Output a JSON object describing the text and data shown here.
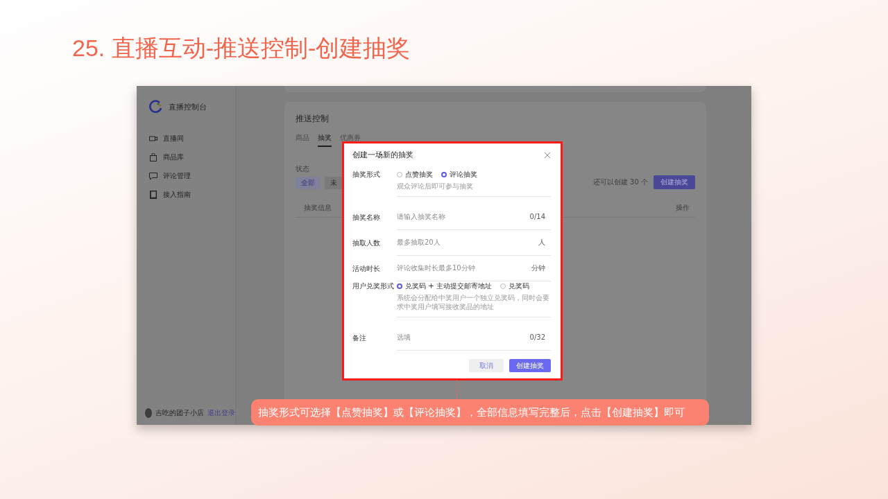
{
  "title": "25. 直播互动-推送控制-创建抽奖",
  "console": {
    "brand": "直播控制台",
    "nav": [
      {
        "label": "直播间"
      },
      {
        "label": "商品库"
      },
      {
        "label": "评论管理"
      },
      {
        "label": "接入指南"
      }
    ],
    "user": {
      "name": "吉吃的团子小店",
      "logout": "退出登录"
    }
  },
  "panel": {
    "title": "推送控制",
    "tabs": [
      {
        "label": "商品",
        "selected": false
      },
      {
        "label": "抽奖",
        "selected": true
      },
      {
        "label": "优惠券",
        "selected": false
      }
    ],
    "status_label": "状态",
    "filters": [
      {
        "label": "全部",
        "selected": true
      },
      {
        "label": "未",
        "selected": false
      }
    ],
    "remaining": "还可以创建 30 个",
    "create_button": "创建抽奖",
    "columns": [
      "抽奖信息",
      "操作"
    ]
  },
  "dialog": {
    "title": "创建一场新的抽奖",
    "rows": [
      {
        "kind": "radio",
        "label": "抽奖形式",
        "options": [
          {
            "label": "点赞抽奖",
            "selected": false
          },
          {
            "label": "评论抽奖",
            "selected": true
          }
        ],
        "hint": "观众评论后即可参与抽奖"
      },
      {
        "kind": "input",
        "label": "抽奖名称",
        "placeholder": "请输入抽奖名称",
        "suffix": "0/14"
      },
      {
        "kind": "input",
        "label": "抽取人数",
        "placeholder": "最多抽取20人",
        "suffix": "人"
      },
      {
        "kind": "input",
        "label": "活动时长",
        "placeholder": "评论收集时长最多10分钟",
        "suffix": "分钟"
      },
      {
        "kind": "radio",
        "label": "用户兑奖形式",
        "options": [
          {
            "label": "兑奖码 + 主动提交邮寄地址",
            "selected": true
          },
          {
            "label": "兑奖码",
            "selected": false
          }
        ],
        "hint": "系统会分配给中奖用户一个独立兑奖码，同时会要求中奖用户填写接收奖品的地址"
      },
      {
        "kind": "input",
        "label": "备注",
        "placeholder": "选填",
        "suffix": "0/32"
      }
    ],
    "buttons": [
      {
        "label": "取消",
        "kind": "secondary"
      },
      {
        "label": "创建抽奖",
        "kind": "primary"
      }
    ]
  },
  "callout": "抽奖形式可选择【点赞抽奖】或【评论抽奖】，全部信息填写完整后，点击【创建抽奖】即可"
}
